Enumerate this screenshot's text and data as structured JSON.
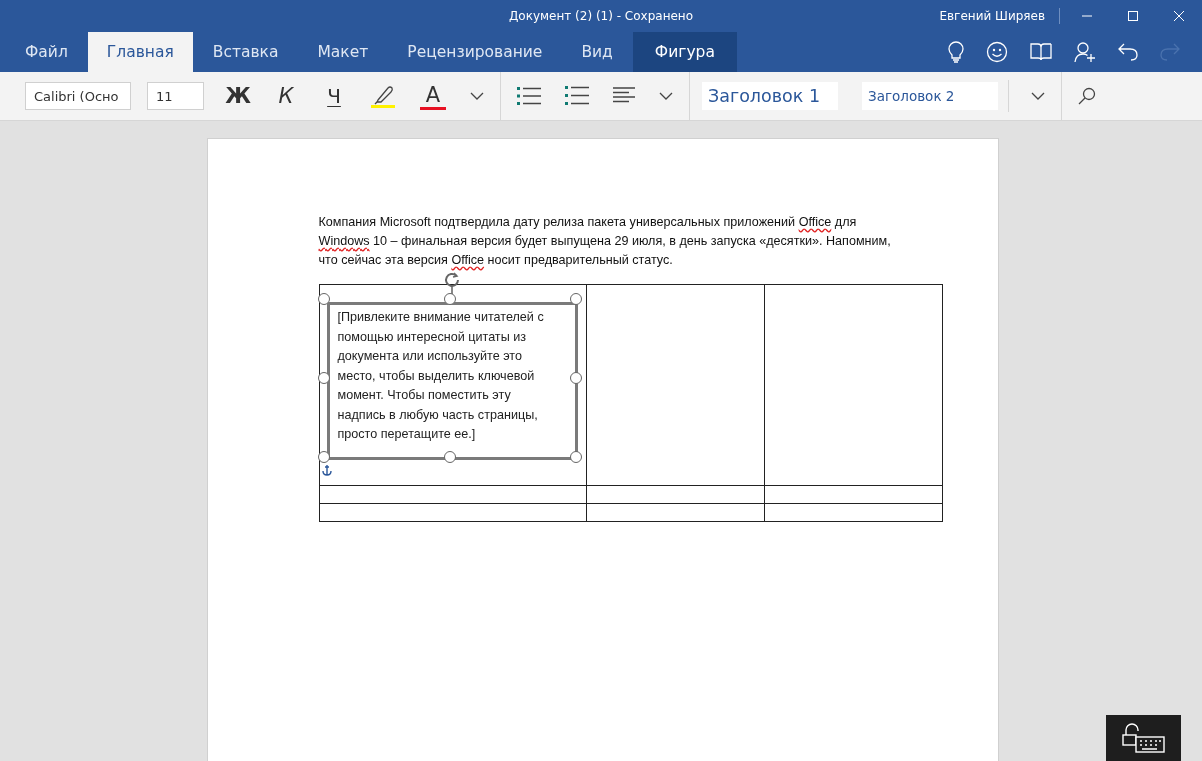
{
  "window": {
    "title": "Документ (2) (1) - Сохранено",
    "user": "Евгений Ширяев"
  },
  "tabs": [
    {
      "label": "Файл",
      "selected": false,
      "kind": "normal"
    },
    {
      "label": "Главная",
      "selected": true,
      "kind": "normal"
    },
    {
      "label": "Вставка",
      "selected": false,
      "kind": "normal"
    },
    {
      "label": "Макет",
      "selected": false,
      "kind": "normal"
    },
    {
      "label": "Рецензирование",
      "selected": false,
      "kind": "normal"
    },
    {
      "label": "Вид",
      "selected": false,
      "kind": "normal"
    },
    {
      "label": "Фигура",
      "selected": false,
      "kind": "contextual"
    }
  ],
  "toolbar": {
    "font": "Calibri (Осно",
    "size": "11",
    "bold": "Ж",
    "italic": "К",
    "underline": "Ч",
    "font_color": "A",
    "styles": [
      "Заголовок 1",
      "Заголовок 2"
    ]
  },
  "paragraph": [
    [
      {
        "text": "Компания Microsoft подтвердила дату релиза пакета универсальных приложений ",
        "misspelled": false
      },
      {
        "text": "Office",
        "misspelled": true
      },
      {
        "text": " для",
        "misspelled": false
      }
    ],
    [
      {
        "text": "Windows",
        "misspelled": true
      },
      {
        "text": " 10 – финальная версия будет выпущена 29 июля, в день запуска «десятки». Напомним,",
        "misspelled": false
      }
    ],
    [
      {
        "text": "что сейчас эта версия ",
        "misspelled": false
      },
      {
        "text": "Office",
        "misspelled": true
      },
      {
        "text": " носит предварительный статус.",
        "misspelled": false
      }
    ]
  ],
  "text_box": {
    "lines": [
      "[Привлеките внимание читателей с",
      "помощью интересной цитаты из",
      "документа или используйте это",
      "место, чтобы выделить ключевой",
      "момент. Чтобы поместить эту",
      "надпись в любую часть страницы,",
      "просто перетащите ее.]"
    ],
    "selected": true
  }
}
